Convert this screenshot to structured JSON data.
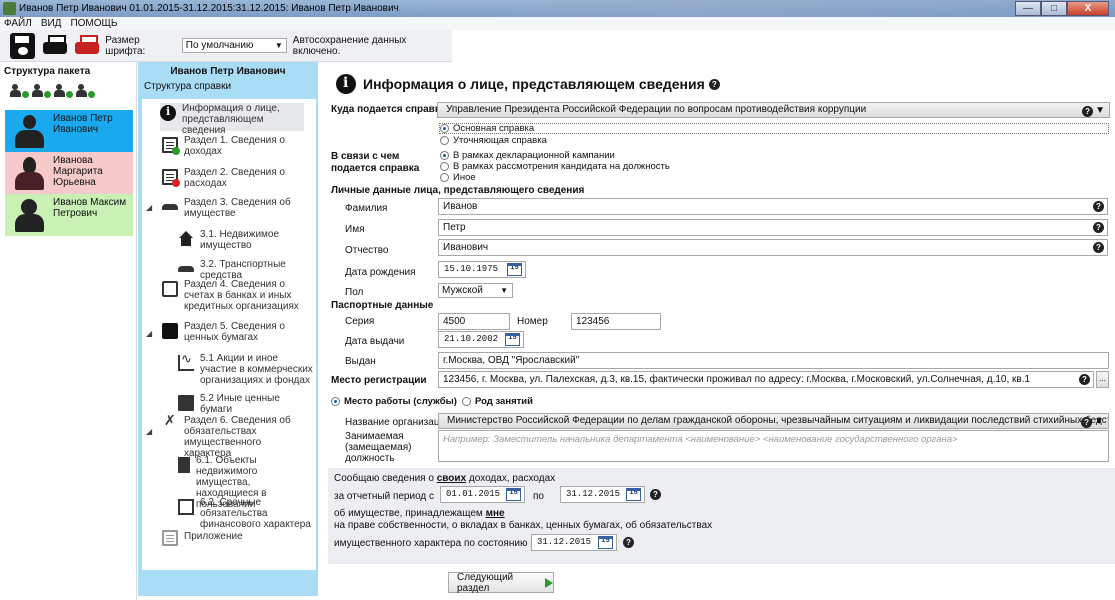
{
  "window": {
    "title": "Иванов Петр Иванович 01.01.2015-31.12.2015:31.12.2015: Иванов Петр Иванович",
    "controls": {
      "minimize": "—",
      "maximize": "□",
      "close": "X"
    }
  },
  "menu": {
    "items": [
      "ФАЙЛ",
      "ВИД",
      "ПОМОЩЬ"
    ]
  },
  "toolbar": {
    "font_size_label": "Размер шрифта:",
    "font_size_value": "По умолчанию",
    "autosave_text": "Автосохранение данных включено."
  },
  "left_panel": {
    "header": "Структура пакета",
    "people": [
      {
        "name": "Иванов Петр Иванович",
        "bg": "#1aa9ef",
        "avatar": "man-avatar"
      },
      {
        "name": "Иванова Маргарита Юрьевна",
        "bg": "#f6c9cb",
        "avatar": "woman-avatar"
      },
      {
        "name": "Иванов Максим Петрович",
        "bg": "#c9f0b5",
        "avatar": "boy-avatar"
      }
    ]
  },
  "nav": {
    "person": "Иванов Петр Иванович",
    "subtitle": "Структура справки",
    "items": [
      {
        "label": "Информация о лице, представляющем сведения",
        "icon": "info-icon"
      },
      {
        "label": "Раздел 1. Сведения о доходах",
        "icon": "income-doc-icon"
      },
      {
        "label": "Раздел 2. Сведения о расходах",
        "icon": "expense-doc-icon"
      },
      {
        "label": "Раздел 3. Сведения об имуществе",
        "icon": "property-icon"
      },
      {
        "label": "3.1. Недвижимое имущество",
        "icon": "house-icon"
      },
      {
        "label": "3.2. Транспортные средства",
        "icon": "car-icon"
      },
      {
        "label": "Раздел 4. Сведения о счетах в банках и иных кредитных организациях",
        "icon": "bank-card-icon"
      },
      {
        "label": "Раздел 5. Сведения о ценных бумагах",
        "icon": "briefcase-icon"
      },
      {
        "label": "5.1 Акции и иное участие в коммерческих организациях и фондах",
        "icon": "stock-chart-icon"
      },
      {
        "label": "5.2 Иные ценные бумаги",
        "icon": "securities-icon"
      },
      {
        "label": "Раздел 6. Сведения об обязательствах имущественного характера",
        "icon": "obligations-icon"
      },
      {
        "label": "6.1. Объекты недвижимого имущества, находящиеся в пользовании",
        "icon": "building-icon"
      },
      {
        "label": "6.2. Срочные обязательства финансового характера",
        "icon": "financial-obligation-icon"
      },
      {
        "label": "Приложение",
        "icon": "attachment-icon"
      }
    ]
  },
  "main": {
    "title": "Информация о лице, представляющем сведения",
    "recipient_label": "Куда подается справка",
    "recipient_value": "Управление Президента Российской Федерации по вопросам противодействия коррупции",
    "report_types": [
      "Основная справка",
      "Уточняющая справка"
    ],
    "reason_label": "В связи с чем подается справка",
    "reasons": [
      "В рамках декларационной кампании",
      "В рамках рассмотрения кандидата на должность",
      "Иное"
    ],
    "personal_header": "Личные данные лица, представляющего сведения",
    "surname_label": "Фамилия",
    "surname": "Иванов",
    "name_label": "Имя",
    "name": "Петр",
    "patronymic_label": "Отчество",
    "patronymic": "Иванович",
    "birth_label": "Дата рождения",
    "birth": "15.10.1975",
    "gender_label": "Пол",
    "gender": "Мужской",
    "passport_header": "Паспортные данные",
    "series_label": "Серия",
    "series": "4500",
    "number_label": "Номер",
    "number": "123456",
    "issue_date_label": "Дата выдачи",
    "issue_date": "21.10.2002",
    "issued_by_label": "Выдан",
    "issued_by": "г.Москва, ОВД \"Ярославский\"",
    "registration_label": "Место регистрации",
    "registration": "123456, г. Москва, ул. Палехская, д.3, кв.15, фактически проживал по адресу: г.Москва, г.Московский, ул.Солнечная, д.10, кв.1",
    "work_option": "Место работы (службы)",
    "occupation_option": "Род занятий",
    "org_label": "Название организации",
    "org_value": "Министерство Российской Федерации по делам гражданской обороны, чрезвычайным ситуациям и ликвидации последствий стихийных бедствий",
    "position_label": "Занимаемая (замещаемая) должность",
    "position_example": "Например:",
    "position_placeholder": "Заместитель начальника департамента <наименование> <наименование государственного органа>",
    "cal_glyph": "15",
    "period": {
      "line1_a": "Сообщаю сведения о",
      "line1_b": "своих",
      "line1_c": "доходах, расходах",
      "period_label": "за отчетный период с",
      "from": "01.01.2015",
      "to_label": "по",
      "to": "31.12.2015",
      "line3_a": "об имуществе, принадлежащем",
      "line3_b": "мне",
      "line4": "на праве собственности, о вкладах в банках, ценных бумагах, об обязательствах",
      "line5": "имущественного характера по состоянию на",
      "as_of": "31.12.2015"
    },
    "next_button": "Следующий раздел",
    "help_glyph": "?",
    "dropdown_glyph": "▼",
    "dots_glyph": "..."
  }
}
